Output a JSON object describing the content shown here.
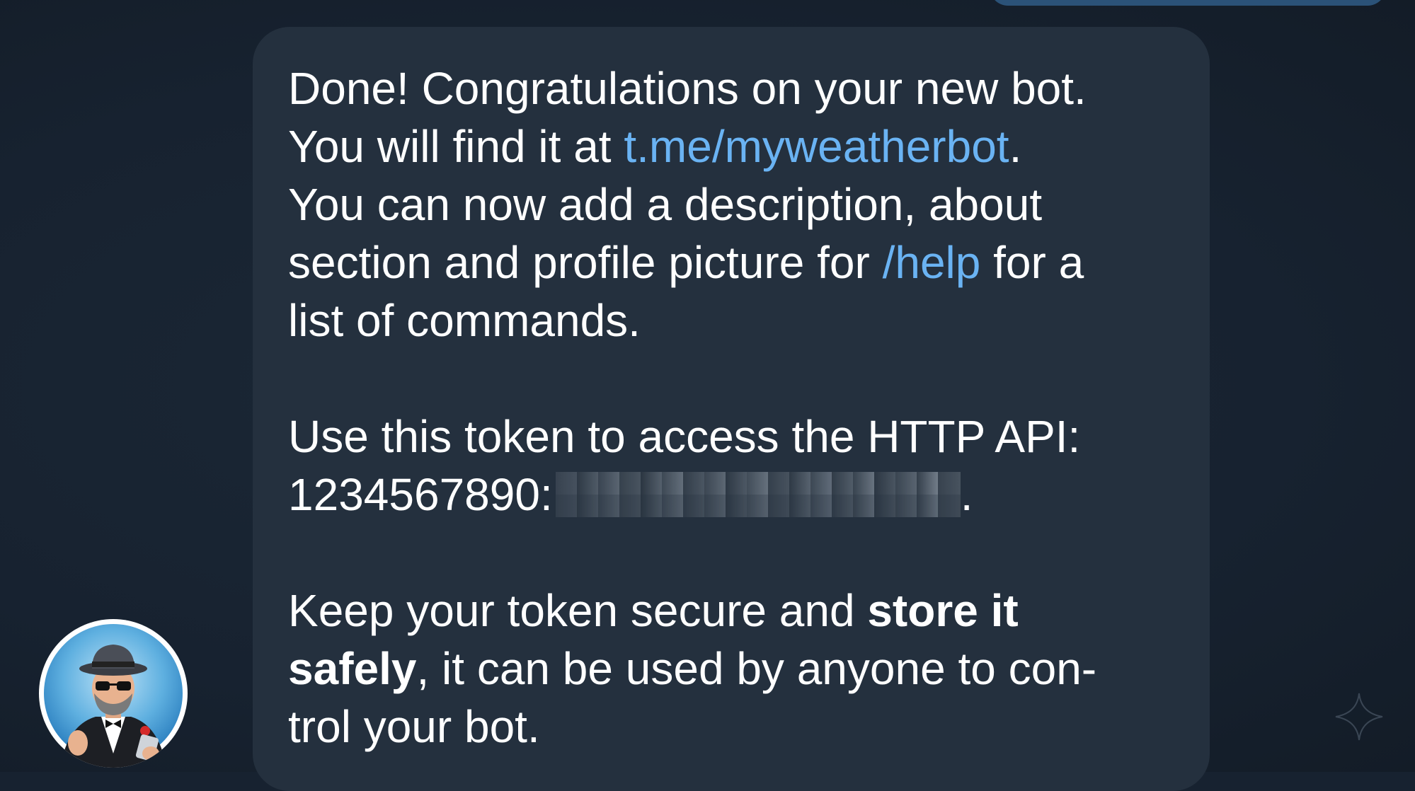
{
  "message": {
    "line1": "Done! Congratulations on your new bot.",
    "line2_prefix": "You will find it at ",
    "bot_link": "t.me/myweatherbot",
    "line2_suffix": ".",
    "line3": "You can now add a description, about",
    "line4_prefix": "section and profile picture for ",
    "help_command": "/help",
    "line4_suffix": " for a",
    "line5": "list of commands.",
    "token_intro": "Use this token to access the HTTP API:",
    "token_prefix": "1234567890:",
    "token_suffix": ".",
    "secure_prefix": "Keep your token secure and ",
    "secure_bold1": "store it",
    "secure_bold2": "safely",
    "secure_mid": ", it can be used by anyone to con-",
    "secure_end": "trol your bot."
  },
  "colors": {
    "background": "#172230",
    "bubble": "#24303e",
    "sent_bubble": "#2b5278",
    "link": "#6ab3f3",
    "text": "#ffffff"
  },
  "icons": {
    "avatar": "botfather-avatar",
    "sparkle": "sparkle-icon"
  }
}
